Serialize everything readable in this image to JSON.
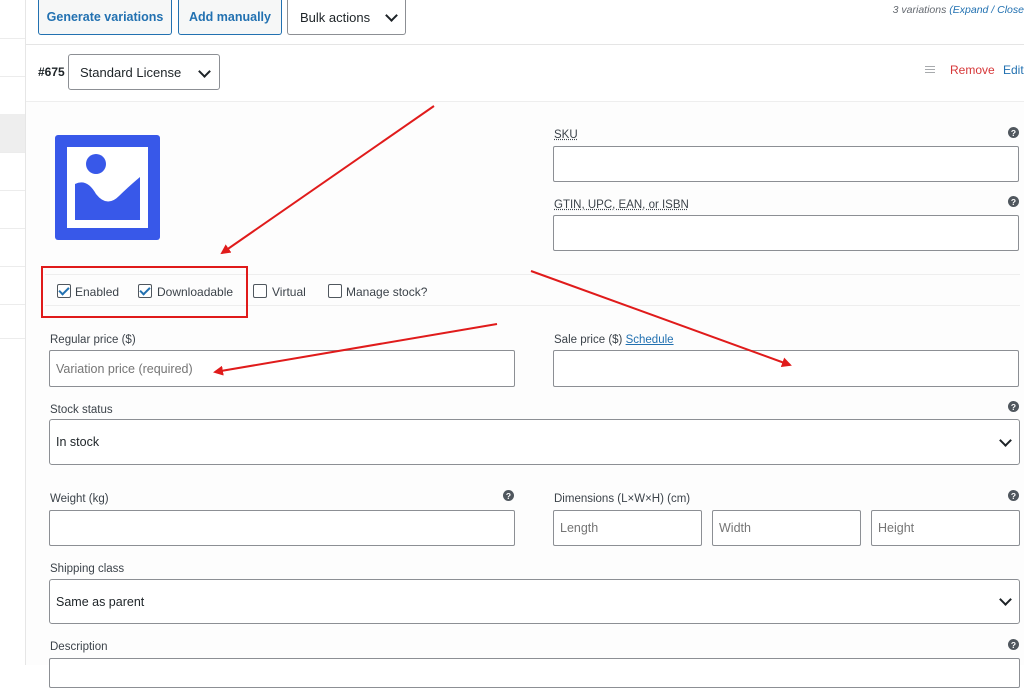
{
  "toolbar": {
    "generate_label": "Generate variations",
    "add_label": "Add manually",
    "bulk_label": "Bulk actions",
    "variations_count": "3 variations",
    "expand_close": "(Expand / Close"
  },
  "variation": {
    "id": "#675",
    "license_value": "Standard License",
    "remove_label": "Remove",
    "edit_label": "Edit"
  },
  "options": {
    "enabled": {
      "label": "Enabled",
      "checked": true
    },
    "downloadable": {
      "label": "Downloadable",
      "checked": true
    },
    "virtual": {
      "label": "Virtual",
      "checked": false
    },
    "manage_stock": {
      "label": "Manage stock?",
      "checked": false
    }
  },
  "fields": {
    "sku_label": "SKU",
    "gtin_label": "GTIN, UPC, EAN, or ISBN",
    "regular_price_label": "Regular price ($)",
    "regular_price_placeholder": "Variation price (required)",
    "sale_price_label": "Sale price ($)",
    "schedule_link": "Schedule",
    "stock_status_label": "Stock status",
    "stock_status_value": "In stock",
    "weight_label": "Weight (kg)",
    "dimensions_label": "Dimensions (L×W×H) (cm)",
    "length_placeholder": "Length",
    "width_placeholder": "Width",
    "height_placeholder": "Height",
    "shipping_class_label": "Shipping class",
    "shipping_class_value": "Same as parent",
    "description_label": "Description"
  },
  "colors": {
    "accent": "#2271b1",
    "remove": "#d63638",
    "annotation": "#e01b1b",
    "image_placeholder": "#3858e9"
  },
  "icons": [
    "image-placeholder-icon",
    "drag-handle-icon",
    "help-icon",
    "chevron-down-icon",
    "checkbox-checked-icon"
  ]
}
